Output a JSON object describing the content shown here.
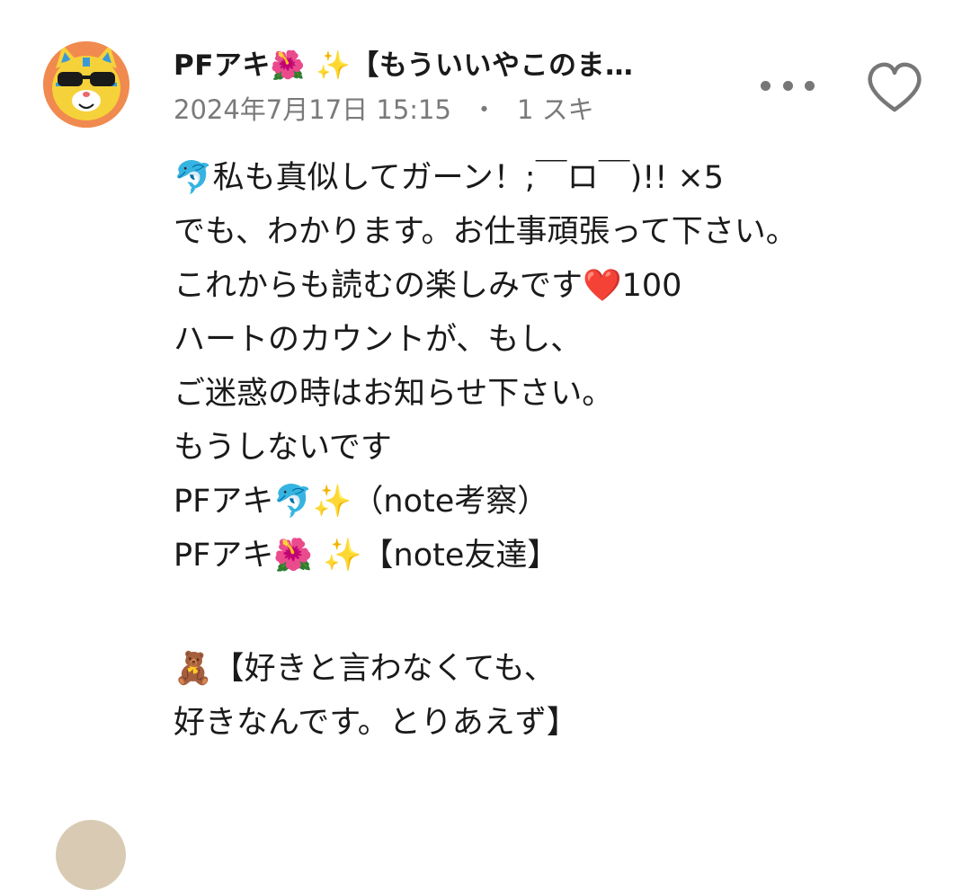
{
  "comment": {
    "username": "PFアキ🌺 ✨【もういいやこのま…",
    "date": "2024年7月17日 15:15",
    "separator": "・",
    "likes": "1 スキ",
    "body_lines": [
      "🐬私も真似してガーン！;￣ロ￣)!! ×5",
      "でも、わかります。お仕事頑張って下さい。",
      "これからも読むの楽しみです❤️100",
      "ハートのカウントが、もし、",
      "ご迷惑の時はお知らせ下さい。",
      "もうしないです",
      "PFアキ🐬✨（note考察）",
      "PFアキ🌺 ✨【note友達】",
      "",
      "🧸【好きと言わなくても、",
      "好きなんです。とりあえず】"
    ]
  },
  "icons": {
    "avatar": "sunglasses-cat-avatar",
    "more": "more-dots-icon",
    "like": "heart-outline-icon",
    "next_avatar": "avatar"
  },
  "colors": {
    "meta_text": "#7a7a7a",
    "icon_gray": "#777777",
    "avatar_bg": "#f08a4f"
  }
}
